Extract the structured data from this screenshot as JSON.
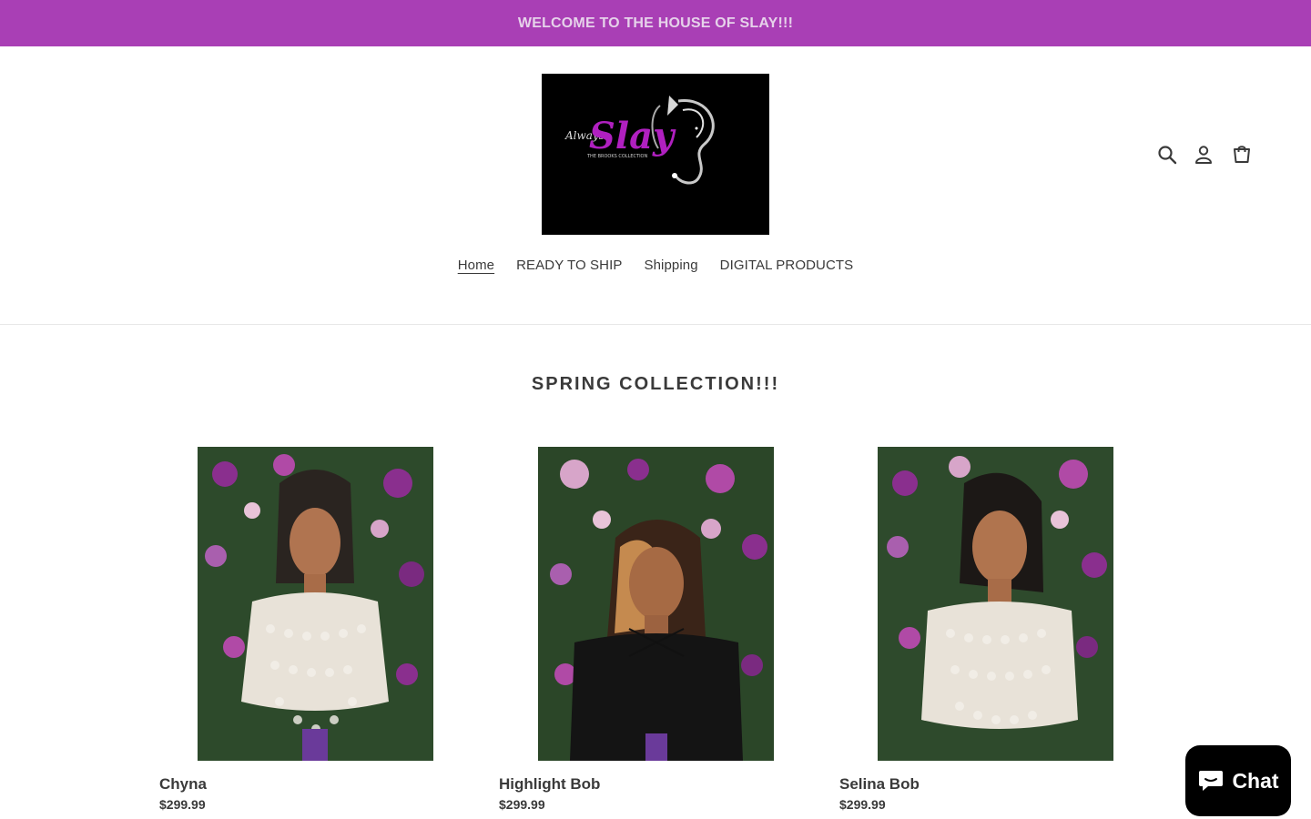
{
  "announcement": {
    "text": "WELCOME TO THE HOUSE OF SLAY!!!"
  },
  "logo": {
    "script_text": "Always",
    "main_text": "Slay",
    "sub_text": "THE BROOKS COLLECTION"
  },
  "header_icons": [
    "search-icon",
    "account-icon",
    "cart-icon"
  ],
  "nav": {
    "items": [
      {
        "label": "Home",
        "active": true
      },
      {
        "label": "READY TO SHIP",
        "active": false
      },
      {
        "label": "Shipping",
        "active": false
      },
      {
        "label": "DIGITAL PRODUCTS",
        "active": false
      }
    ]
  },
  "section": {
    "title": "SPRING COLLECTION!!!"
  },
  "products": [
    {
      "name": "Chyna",
      "price": "$299.99"
    },
    {
      "name": "Highlight Bob",
      "price": "$299.99"
    },
    {
      "name": "Selina Bob",
      "price": "$299.99"
    }
  ],
  "chat": {
    "label": "Chat"
  },
  "colors": {
    "announcement_bg": "#a93fb5",
    "logo_accent": "#b020c0",
    "text": "#3a3a3a"
  }
}
